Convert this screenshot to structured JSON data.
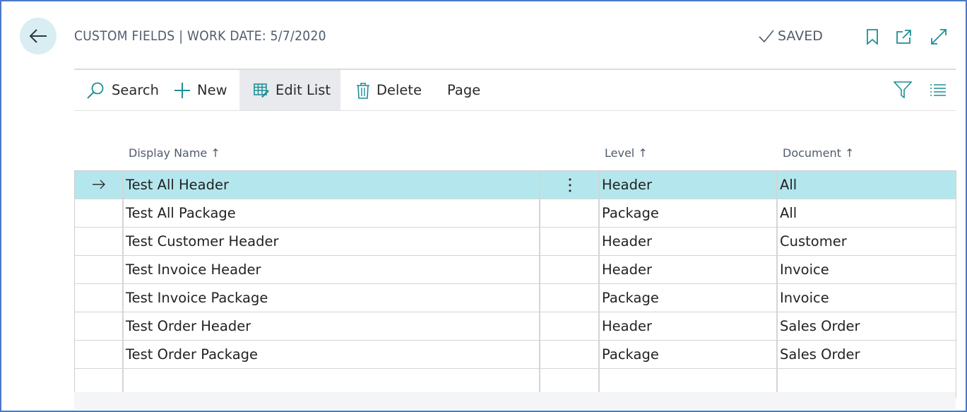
{
  "header": {
    "title": "CUSTOM FIELDS | WORK DATE: 5/7/2020",
    "status": "SAVED",
    "icons": [
      "back-arrow-icon",
      "bookmark-icon",
      "open-new-window-icon",
      "expand-icon"
    ]
  },
  "actions": {
    "search": "Search",
    "new": "New",
    "edit_list": "Edit List",
    "delete": "Delete",
    "page": "Page"
  },
  "columns": {
    "display_name": "Display Name",
    "level": "Level",
    "document": "Document",
    "sort_glyph": "↑"
  },
  "rows": [
    {
      "display_name": "Test All Header",
      "level": "Header",
      "document": "All"
    },
    {
      "display_name": "Test All Package",
      "level": "Package",
      "document": "All"
    },
    {
      "display_name": "Test Customer Header",
      "level": "Header",
      "document": "Customer"
    },
    {
      "display_name": "Test Invoice Header",
      "level": "Header",
      "document": "Invoice"
    },
    {
      "display_name": "Test Invoice Package",
      "level": "Package",
      "document": "Invoice"
    },
    {
      "display_name": "Test Order Header",
      "level": "Header",
      "document": "Sales Order"
    },
    {
      "display_name": "Test Order Package",
      "level": "Package",
      "document": "Sales Order"
    },
    {
      "display_name": "",
      "level": "",
      "document": ""
    }
  ],
  "selected_row_index": 0,
  "colors": {
    "accent": "#1d8f96",
    "selected_row": "#b4e7ed",
    "frame_border": "#4a7ac7",
    "back_button_bg": "#d8eef2"
  }
}
